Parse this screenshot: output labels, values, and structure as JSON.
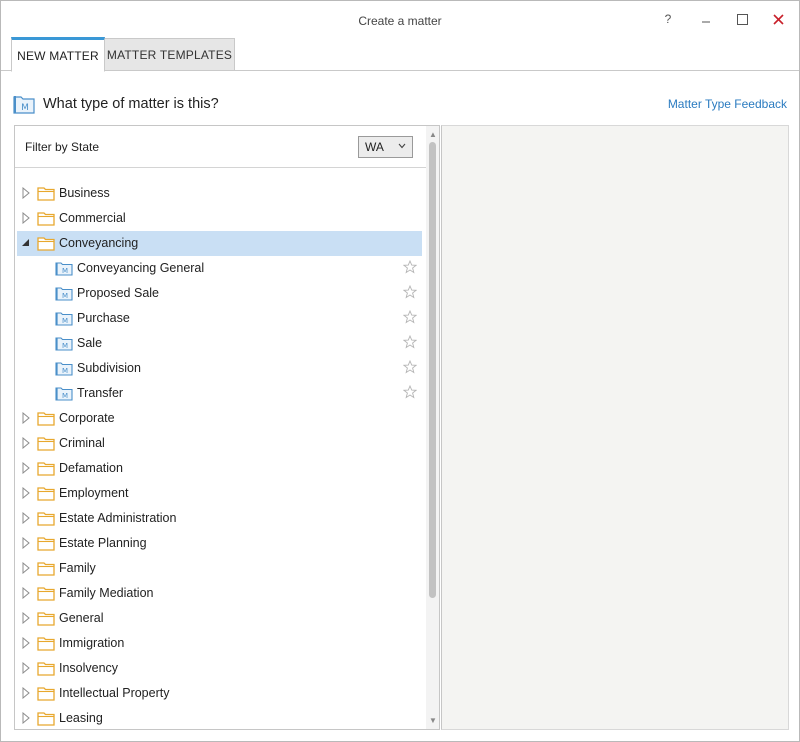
{
  "window": {
    "title": "Create a matter",
    "help_label": "?",
    "minimize_label": "–",
    "close_label": "✕"
  },
  "tabs": [
    {
      "label": "NEW MATTER",
      "active": true
    },
    {
      "label": "MATTER TEMPLATES",
      "active": false
    }
  ],
  "heading": {
    "text": "What type of matter is this?",
    "feedback_link": "Matter Type Feedback"
  },
  "filter": {
    "label": "Filter by State",
    "selected_state": "WA"
  },
  "tree": {
    "folders": [
      {
        "label": "Business",
        "expanded": false
      },
      {
        "label": "Commercial",
        "expanded": false
      },
      {
        "label": "Conveyancing",
        "expanded": true,
        "selected": true,
        "children": [
          "Conveyancing General",
          "Proposed Sale",
          "Purchase",
          "Sale",
          "Subdivision",
          "Transfer"
        ]
      },
      {
        "label": "Corporate",
        "expanded": false
      },
      {
        "label": "Criminal",
        "expanded": false
      },
      {
        "label": "Defamation",
        "expanded": false
      },
      {
        "label": "Employment",
        "expanded": false
      },
      {
        "label": "Estate Administration",
        "expanded": false
      },
      {
        "label": "Estate Planning",
        "expanded": false
      },
      {
        "label": "Family",
        "expanded": false
      },
      {
        "label": "Family Mediation",
        "expanded": false
      },
      {
        "label": "General",
        "expanded": false
      },
      {
        "label": "Immigration",
        "expanded": false
      },
      {
        "label": "Insolvency",
        "expanded": false
      },
      {
        "label": "Intellectual Property",
        "expanded": false
      },
      {
        "label": "Leasing",
        "expanded": false
      }
    ]
  },
  "colors": {
    "accent": "#3a98d6",
    "link": "#2a7bc0",
    "folder": "#e8a82e",
    "selected_row": "#c9dff4",
    "close": "#c8202a",
    "matter_icon": "#4a8fc9"
  },
  "icons": {
    "folder": "folder-icon",
    "matter_type": "matter-type-icon",
    "favorite": "star-outline-icon",
    "collapsed": "triangle-right-icon",
    "expanded": "triangle-down-icon"
  }
}
